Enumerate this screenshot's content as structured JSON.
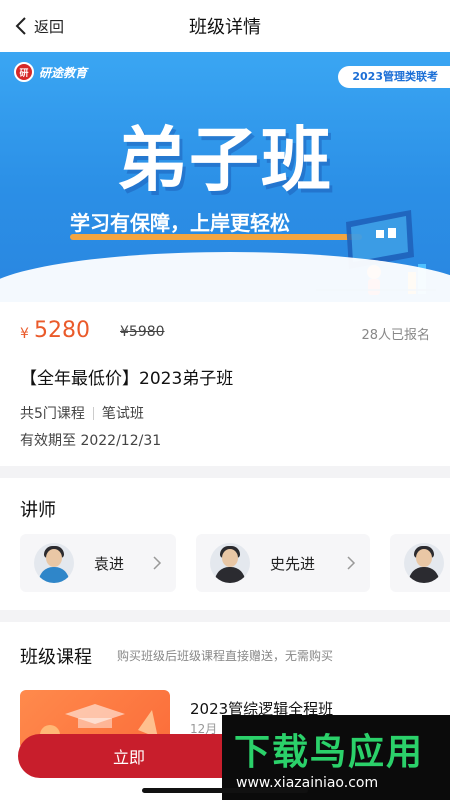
{
  "nav": {
    "back_label": "返回",
    "title": "班级详情"
  },
  "banner": {
    "logo_text": "研途教育",
    "tag": "2023管理类联考",
    "title": "弟子班",
    "slogan": "学习有保障，上岸更轻松"
  },
  "price": {
    "currency": "¥",
    "current": "5280",
    "original": "¥5980",
    "enrolled": "28人已报名"
  },
  "course": {
    "title": "【全年最低价】2023弟子班",
    "lessons": "共5门课程",
    "type": "笔试班",
    "validity": "有效期至 2022/12/31"
  },
  "teachers": {
    "heading": "讲师",
    "items": [
      {
        "name": "袁进"
      },
      {
        "name": "史先进"
      }
    ]
  },
  "class_courses": {
    "heading": "班级课程",
    "subtitle": "购买班级后班级课程直接赠送，无需购买",
    "items": [
      {
        "name": "2023管综逻辑全程班",
        "meta": "12月"
      }
    ]
  },
  "buy_button": {
    "label": "立即"
  },
  "watermark": {
    "main": "下载鸟应用",
    "url": "www.xiazainiao.com"
  },
  "colors": {
    "price": "#ea5a2a",
    "buy": "#c81e2c",
    "banner": "#2b8fe6",
    "watermark_green": "#2bd16a"
  }
}
